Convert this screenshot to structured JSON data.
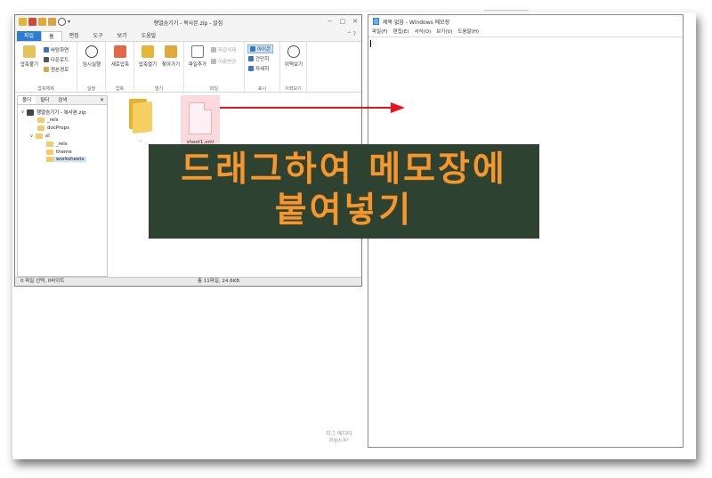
{
  "alzip": {
    "title": "행열슴기기 - 복사본.zip - 알집",
    "window_controls": [
      "−",
      "□",
      "✕"
    ],
    "quick_access_caret": "▾",
    "tabs": [
      {
        "label": "파일"
      },
      {
        "label": "홈"
      },
      {
        "label": "편집"
      },
      {
        "label": "도구"
      },
      {
        "label": "보기"
      },
      {
        "label": "도움말"
      }
    ],
    "help_icon": "⌃ ?",
    "ribbon": {
      "extract": {
        "big": "압축풀기",
        "small": [
          "바탕화면",
          "다운로드",
          "원본경로"
        ],
        "group": "압축해제"
      },
      "run": {
        "big": "임시실행",
        "group": "실행"
      },
      "compress": {
        "big": "새로압축",
        "group": "압축"
      },
      "open": {
        "big1": "압축열기",
        "big2": "찾아가기",
        "group": "열기"
      },
      "file": {
        "big": "파일추가",
        "small": [
          "파일삭제",
          "이름변경"
        ],
        "group": "파일"
      },
      "view": {
        "small": [
          "아이콘",
          "간단히",
          "자세히"
        ],
        "group": "표시"
      },
      "history": {
        "big": "이력보기",
        "group": "이력보기"
      }
    },
    "left_panel": {
      "tabs": [
        "폴더",
        "필터",
        "검색"
      ],
      "close": "✕",
      "tree": {
        "root": "행열슴기기 - 복사본.zip",
        "items": [
          "_rels",
          "docProps",
          "xl",
          "_rels",
          "theme",
          "worksheets"
        ]
      }
    },
    "files": [
      {
        "name": ".."
      },
      {
        "name": "sheet1.xml"
      }
    ],
    "status": {
      "left": "0 파일 선택, 0바이트",
      "center": "총 11파일, 24.6KB"
    }
  },
  "notepad": {
    "title": "제목 없음 - Windows 메모장",
    "menu": [
      "파일(F)",
      "편집(E)",
      "서식(O)",
      "보기(V)",
      "도움말(H)"
    ]
  },
  "overlay": {
    "banner_line1": "드래그하여 메모장에",
    "banner_line2": "붙여넣기",
    "banner_bg": "#2e4232",
    "banner_fg": "#f7962a",
    "arrow_color": "#e8141b",
    "watermark_line1": "지그 에디터",
    "watermark_line2": "zigui.kr"
  }
}
